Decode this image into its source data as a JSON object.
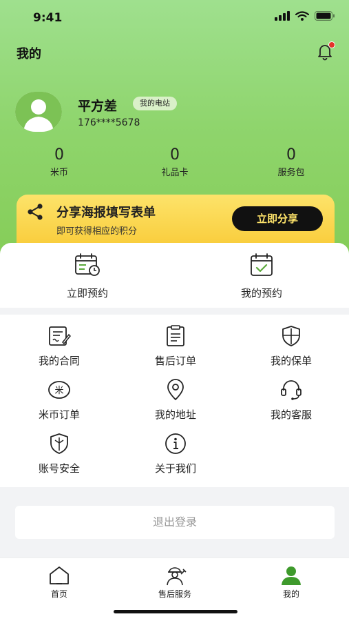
{
  "status_bar": {
    "time": "9:41"
  },
  "header": {
    "title": "我的"
  },
  "profile": {
    "name": "平方差",
    "badge": "我的电站",
    "phone": "176****5678"
  },
  "stats": [
    {
      "value": "0",
      "label": "米币"
    },
    {
      "value": "0",
      "label": "礼品卡"
    },
    {
      "value": "0",
      "label": "服务包"
    }
  ],
  "share_banner": {
    "title": "分享海报填写表单",
    "subtitle": "即可获得相应的积分",
    "button": "立即分享"
  },
  "booking": [
    {
      "label": "立即预约",
      "icon": "calendar-clock-icon"
    },
    {
      "label": "我的预约",
      "icon": "calendar-check-icon"
    }
  ],
  "menu": [
    {
      "label": "我的合同",
      "icon": "contract-icon"
    },
    {
      "label": "售后订单",
      "icon": "order-list-icon"
    },
    {
      "label": "我的保单",
      "icon": "shield-icon"
    },
    {
      "label": "米币订单",
      "icon": "mi-coin-icon"
    },
    {
      "label": "我的地址",
      "icon": "location-pin-icon"
    },
    {
      "label": "我的客服",
      "icon": "headset-icon"
    },
    {
      "label": "账号安全",
      "icon": "shield-check-icon"
    },
    {
      "label": "关于我们",
      "icon": "info-icon"
    }
  ],
  "logout": {
    "label": "退出登录"
  },
  "tabbar": [
    {
      "label": "首页",
      "icon": "home-icon"
    },
    {
      "label": "售后服务",
      "icon": "technician-icon"
    },
    {
      "label": "我的",
      "icon": "user-icon",
      "active": true
    }
  ],
  "colors": {
    "brand_green": "#84cc55",
    "active_tab": "#3e9a2c",
    "banner_yellow": "#f8c832",
    "notification_red": "#e5342a"
  }
}
